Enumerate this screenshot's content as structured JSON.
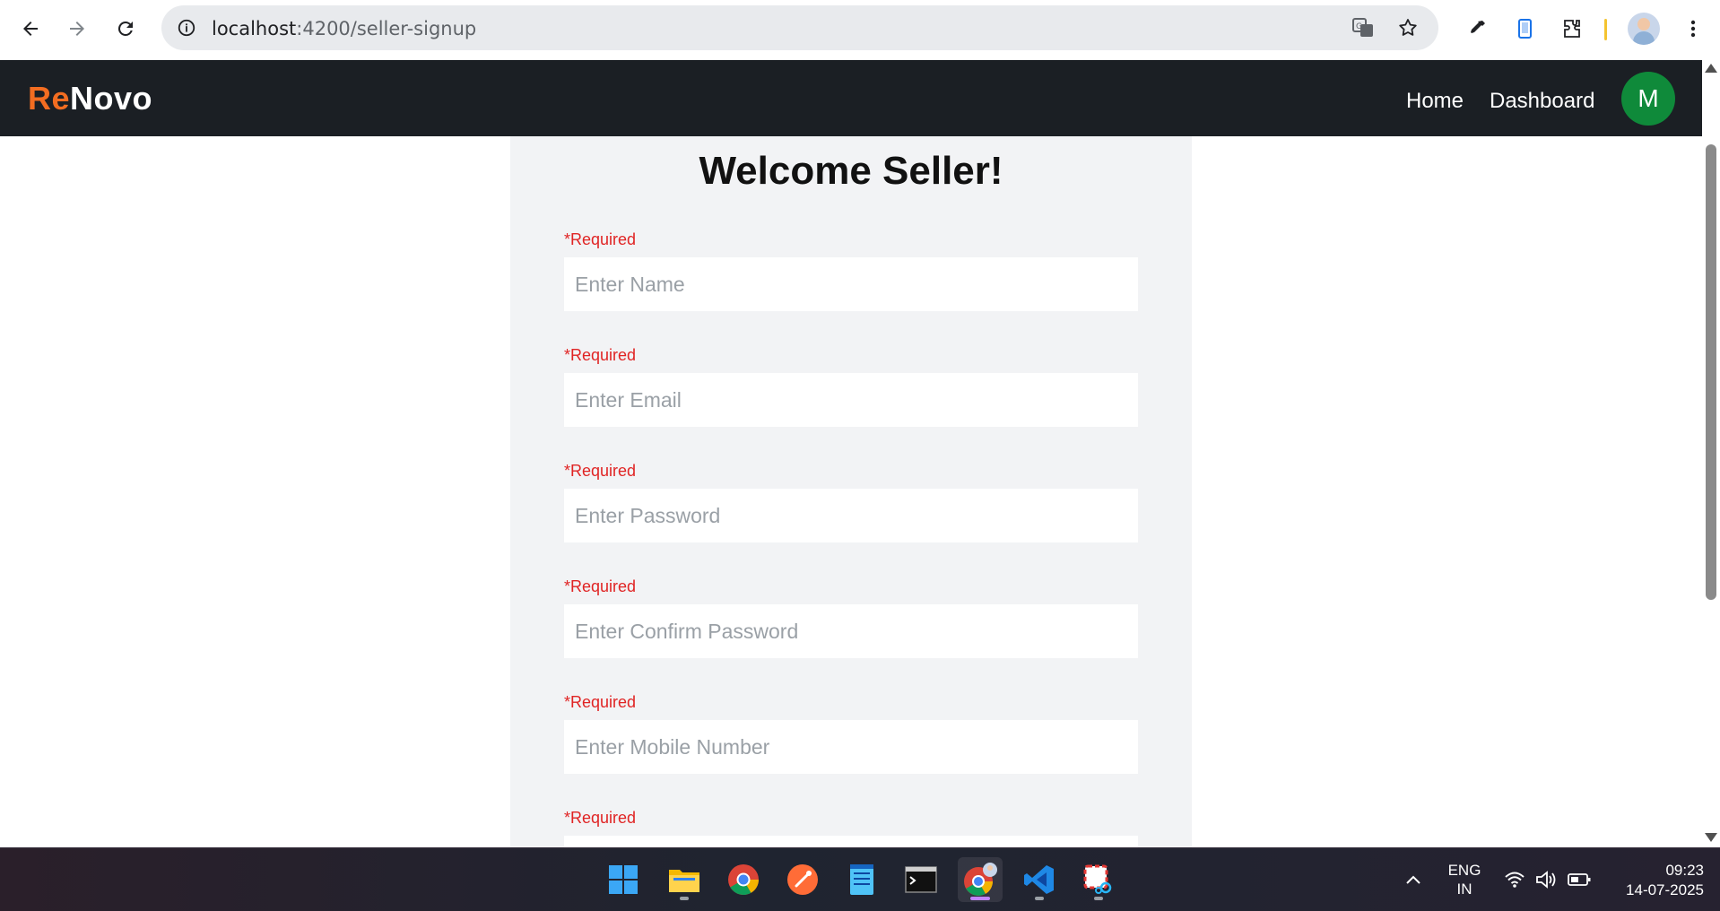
{
  "browser": {
    "url_host": "localhost",
    "url_path": ":4200/seller-signup",
    "icons": [
      "back-arrow-icon",
      "forward-arrow-icon",
      "reload-icon",
      "site-info-icon",
      "translate-icon",
      "bookmark-star-icon",
      "eyedropper-icon",
      "phone-icon",
      "extensions-icon",
      "profile-avatar",
      "menu-kebab-icon"
    ]
  },
  "header": {
    "logo_accent": "Re",
    "logo_rest": "Novo",
    "nav": [
      "Home",
      "Dashboard"
    ],
    "avatar_initial": "M",
    "colors": {
      "background": "#1b1f24",
      "accent": "#f36d21",
      "avatar": "#0f8a3a"
    }
  },
  "form": {
    "title": "Welcome Seller!",
    "fields": [
      {
        "required_label": "*Required",
        "placeholder": "Enter Name"
      },
      {
        "required_label": "*Required",
        "placeholder": "Enter Email"
      },
      {
        "required_label": "*Required",
        "placeholder": "Enter Password"
      },
      {
        "required_label": "*Required",
        "placeholder": "Enter Confirm Password"
      },
      {
        "required_label": "*Required",
        "placeholder": "Enter Mobile Number"
      },
      {
        "required_label": "*Required",
        "placeholder": ""
      }
    ],
    "colors": {
      "panel": "#f2f3f5",
      "required": "#e02424"
    }
  },
  "taskbar": {
    "apps": [
      "windows-start-icon",
      "file-explorer-icon",
      "chrome-icon",
      "postman-icon",
      "notepad-icon",
      "terminal-icon",
      "chrome-profile-icon",
      "vscode-icon",
      "snipping-tool-icon"
    ],
    "language_line1": "ENG",
    "language_line2": "IN",
    "time": "09:23",
    "date": "14-07-2025"
  }
}
